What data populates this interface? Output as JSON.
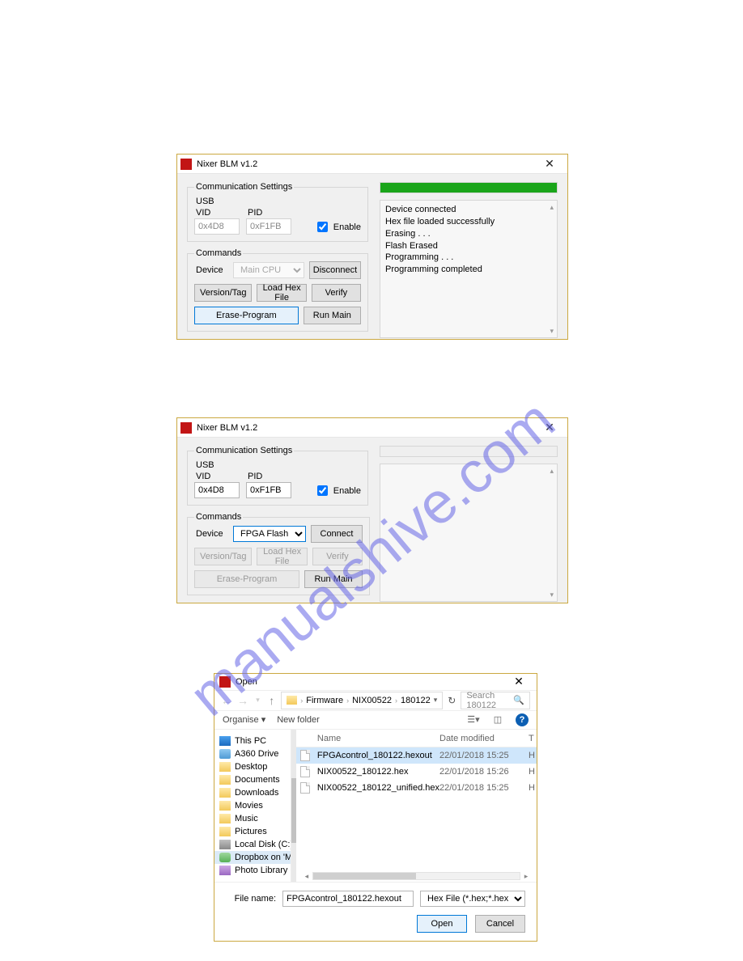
{
  "watermark": "manualshive.com",
  "win1": {
    "title": "Nixer BLM v1.2",
    "comm_legend": "Communication Settings",
    "usb_label": "USB",
    "vid_label": "VID",
    "pid_label": "PID",
    "vid_value": "0x4D8",
    "pid_value": "0xF1FB",
    "enable_label": "Enable",
    "cmds_legend": "Commands",
    "device_label": "Device",
    "device_value": "Main CPU",
    "conn_btn": "Disconnect",
    "version_btn": "Version/Tag",
    "load_btn": "Load Hex File",
    "verify_btn": "Verify",
    "erase_btn": "Erase-Program",
    "run_btn": "Run Main",
    "log_lines": [
      "Device connected",
      "Hex file loaded successfully",
      "Erasing . . .",
      "Flash Erased",
      "Programming . . .",
      "Programming completed"
    ]
  },
  "win2": {
    "title": "Nixer BLM v1.2",
    "comm_legend": "Communication Settings",
    "usb_label": "USB",
    "vid_label": "VID",
    "pid_label": "PID",
    "vid_value": "0x4D8",
    "pid_value": "0xF1FB",
    "enable_label": "Enable",
    "cmds_legend": "Commands",
    "device_label": "Device",
    "device_value": "FPGA Flash",
    "conn_btn": "Connect",
    "version_btn": "Version/Tag",
    "load_btn": "Load Hex File",
    "verify_btn": "Verify",
    "erase_btn": "Erase-Program",
    "run_btn": "Run Main"
  },
  "fd": {
    "title": "Open",
    "crumbs": [
      "Firmware",
      "NIX00522",
      "180122"
    ],
    "search_placeholder": "Search 180122",
    "organise": "Organise ▾",
    "newfolder": "New folder",
    "tree": [
      {
        "label": "This PC",
        "icon": "pc"
      },
      {
        "label": "A360 Drive",
        "icon": "drv"
      },
      {
        "label": "Desktop",
        "icon": "fld"
      },
      {
        "label": "Documents",
        "icon": "fld"
      },
      {
        "label": "Downloads",
        "icon": "fld"
      },
      {
        "label": "Movies",
        "icon": "fld"
      },
      {
        "label": "Music",
        "icon": "fld"
      },
      {
        "label": "Pictures",
        "icon": "fld"
      },
      {
        "label": "Local Disk (C:)",
        "icon": "disk"
      },
      {
        "label": "Dropbox on 'Ma",
        "icon": "cloud"
      },
      {
        "label": "Photo Library on",
        "icon": "lib"
      }
    ],
    "col_name": "Name",
    "col_date": "Date modified",
    "col_t": "T",
    "files": [
      {
        "name": "FPGAcontrol_180122.hexout",
        "date": "22/01/2018 15:25",
        "t": "H",
        "sel": true
      },
      {
        "name": "NIX00522_180122.hex",
        "date": "22/01/2018 15:26",
        "t": "H",
        "sel": false
      },
      {
        "name": "NIX00522_180122_unified.hex",
        "date": "22/01/2018 15:25",
        "t": "H",
        "sel": false
      }
    ],
    "fn_label": "File name:",
    "fn_value": "FPGAcontrol_180122.hexout",
    "filter": "Hex File (*.hex;*.hexout)",
    "open_btn": "Open",
    "cancel_btn": "Cancel"
  }
}
